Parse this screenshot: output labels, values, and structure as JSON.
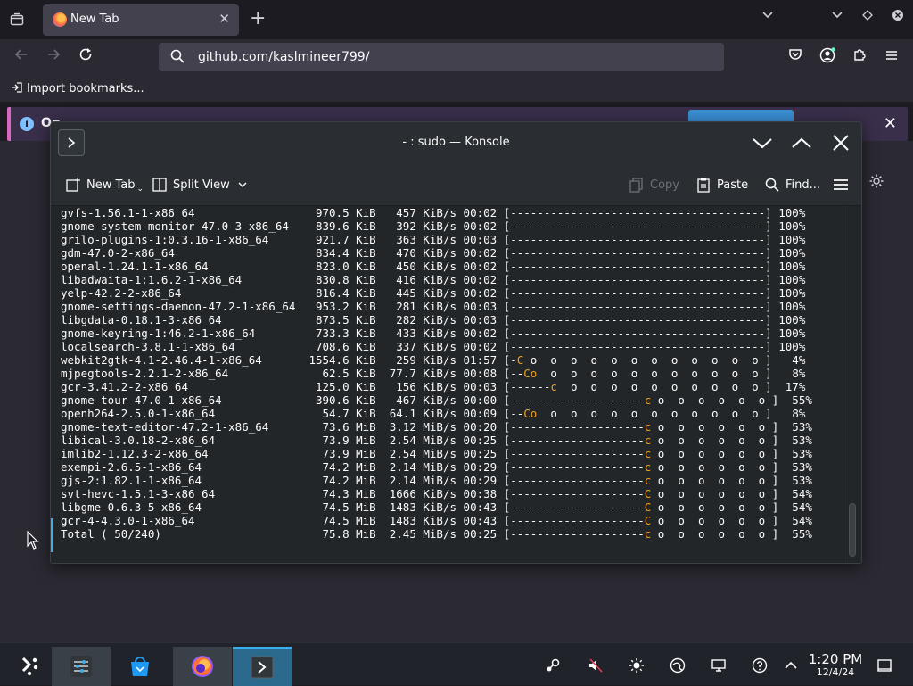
{
  "browser": {
    "tab_title": "New Tab",
    "url": "github.com/kaslmineer799/",
    "bookmark_item": "Import bookmarks...",
    "notification_text": "Op"
  },
  "konsole": {
    "title": "- : sudo — Konsole",
    "toolbar": {
      "new_tab": "New Tab",
      "split_view": "Split View",
      "copy": "Copy",
      "paste": "Paste",
      "find": "Find..."
    },
    "lines": [
      {
        "text": "gvfs-1.56.1-1-x86_64                  970.5 KiB   457 KiB/s 00:02 [--------------------------------------] 100%"
      },
      {
        "text": "gnome-system-monitor-47.0-3-x86_64    839.6 KiB   392 KiB/s 00:02 [--------------------------------------] 100%"
      },
      {
        "text": "grilo-plugins-1:0.3.16-1-x86_64       921.7 KiB   363 KiB/s 00:03 [--------------------------------------] 100%"
      },
      {
        "text": "gdm-47.0-2-x86_64                     834.4 KiB   470 KiB/s 00:02 [--------------------------------------] 100%"
      },
      {
        "text": "openal-1.24.1-1-x86_64                823.0 KiB   450 KiB/s 00:02 [--------------------------------------] 100%"
      },
      {
        "text": "libadwaita-1:1.6.2-1-x86_64           830.8 KiB   416 KiB/s 00:02 [--------------------------------------] 100%"
      },
      {
        "text": "yelp-42.2-2-x86_64                    816.4 KiB   445 KiB/s 00:02 [--------------------------------------] 100%"
      },
      {
        "text": "gnome-settings-daemon-47.2-1-x86_64   953.2 KiB   281 KiB/s 00:03 [--------------------------------------] 100%"
      },
      {
        "text": "libgdata-0.18.1-3-x86_64              873.5 KiB   282 KiB/s 00:03 [--------------------------------------] 100%"
      },
      {
        "text": "gnome-keyring-1:46.2-1-x86_64         733.3 KiB   433 KiB/s 00:02 [--------------------------------------] 100%"
      },
      {
        "text": "localsearch-3.8.1-1-x86_64            708.6 KiB   337 KiB/s 00:02 [--------------------------------------] 100%"
      },
      {
        "pre": "webkit2gtk-4.1-2.46.4-1-x86_64       1554.6 KiB   259 KiB/s 01:57 [-",
        "hl": "C",
        "post": " o  o  o  o  o  o  o  o  o  o  o  o ]   4%"
      },
      {
        "pre": "mjpegtools-2.2.1-2-x86_64              62.5 KiB  77.7 KiB/s 00:08 [--",
        "hl": "Co",
        "post": "  o  o  o  o  o  o  o  o  o  o  o ]   8%"
      },
      {
        "pre": "gcr-3.41.2-2-x86_64                   125.0 KiB   156 KiB/s 00:03 [------",
        "hl": "c",
        "post": "  o  o  o  o  o  o  o  o  o  o ]  17%"
      },
      {
        "pre": "gnome-tour-47.0-1-x86_64              390.6 KiB   467 KiB/s 00:00 [--------------------",
        "hl": "c",
        "post": " o  o  o  o  o  o ]  55%"
      },
      {
        "pre": "openh264-2.5.0-1-x86_64                54.7 KiB  64.1 KiB/s 00:09 [--",
        "hl": "Co",
        "post": "  o  o  o  o  o  o  o  o  o  o  o ]   8%"
      },
      {
        "pre": "gnome-text-editor-47.2-1-x86_64        73.6 MiB  3.12 MiB/s 00:20 [--------------------",
        "hl": "c",
        "post": " o  o  o  o  o  o ]  53%"
      },
      {
        "pre": "libical-3.0.18-2-x86_64                73.9 MiB  2.54 MiB/s 00:25 [--------------------",
        "hl": "c",
        "post": " o  o  o  o  o  o ]  53%"
      },
      {
        "pre": "imlib2-1.12.3-2-x86_64                 73.9 MiB  2.54 MiB/s 00:25 [--------------------",
        "hl": "c",
        "post": " o  o  o  o  o  o ]  53%"
      },
      {
        "pre": "exempi-2.6.5-1-x86_64                  74.2 MiB  2.14 MiB/s 00:29 [--------------------",
        "hl": "c",
        "post": " o  o  o  o  o  o ]  53%"
      },
      {
        "pre": "gjs-2:1.82.1-1-x86_64                  74.2 MiB  2.14 MiB/s 00:29 [--------------------",
        "hl": "c",
        "post": " o  o  o  o  o  o ]  53%"
      },
      {
        "pre": "svt-hevc-1.5.1-3-x86_64                74.3 MiB  1666 KiB/s 00:38 [--------------------",
        "hl": "C",
        "post": " o  o  o  o  o  o ]  54%"
      },
      {
        "pre": "libgme-0.6.3-5-x86_64                  74.5 MiB  1483 KiB/s 00:43 [--------------------",
        "hl": "C",
        "post": " o  o  o  o  o  o ]  54%"
      },
      {
        "pre": "gcr-4-4.3.0-1-x86_64                   74.5 MiB  1483 KiB/s 00:43 [--------------------",
        "hl": "C",
        "post": " o  o  o  o  o  o ]  54%"
      },
      {
        "pre": "Total ( 50/240)                        75.8 MiB  2.45 MiB/s 00:25 [--------------------",
        "hl": "c",
        "post": " o  o  o  o  o  o ]  55%"
      }
    ]
  },
  "taskbar": {
    "time": "1:20 PM",
    "date": "12/4/24"
  },
  "colors": {
    "accent": "#3daee9",
    "progress_highlight": "#f0a020",
    "notification_border": "#d669be"
  },
  "icons": [
    "overview-icon",
    "firefox-icon",
    "close-icon",
    "plus-icon",
    "chevron-down-icon",
    "back-arrow-icon",
    "forward-arrow-icon",
    "reload-icon",
    "search-icon",
    "pocket-icon",
    "account-icon",
    "extensions-icon",
    "menu-icon",
    "import-icon",
    "info-icon",
    "terminal-icon",
    "minimize-icon",
    "maximize-icon",
    "new-tab-icon",
    "split-view-icon",
    "copy-icon",
    "paste-icon",
    "find-icon",
    "hamburger-icon",
    "gear-icon",
    "kde-launcher-icon",
    "system-settings-icon",
    "discover-store-icon",
    "volume-muted-icon",
    "brightness-icon",
    "network-icon",
    "display-icon",
    "help-icon",
    "tray-expand-icon",
    "show-desktop-icon"
  ]
}
